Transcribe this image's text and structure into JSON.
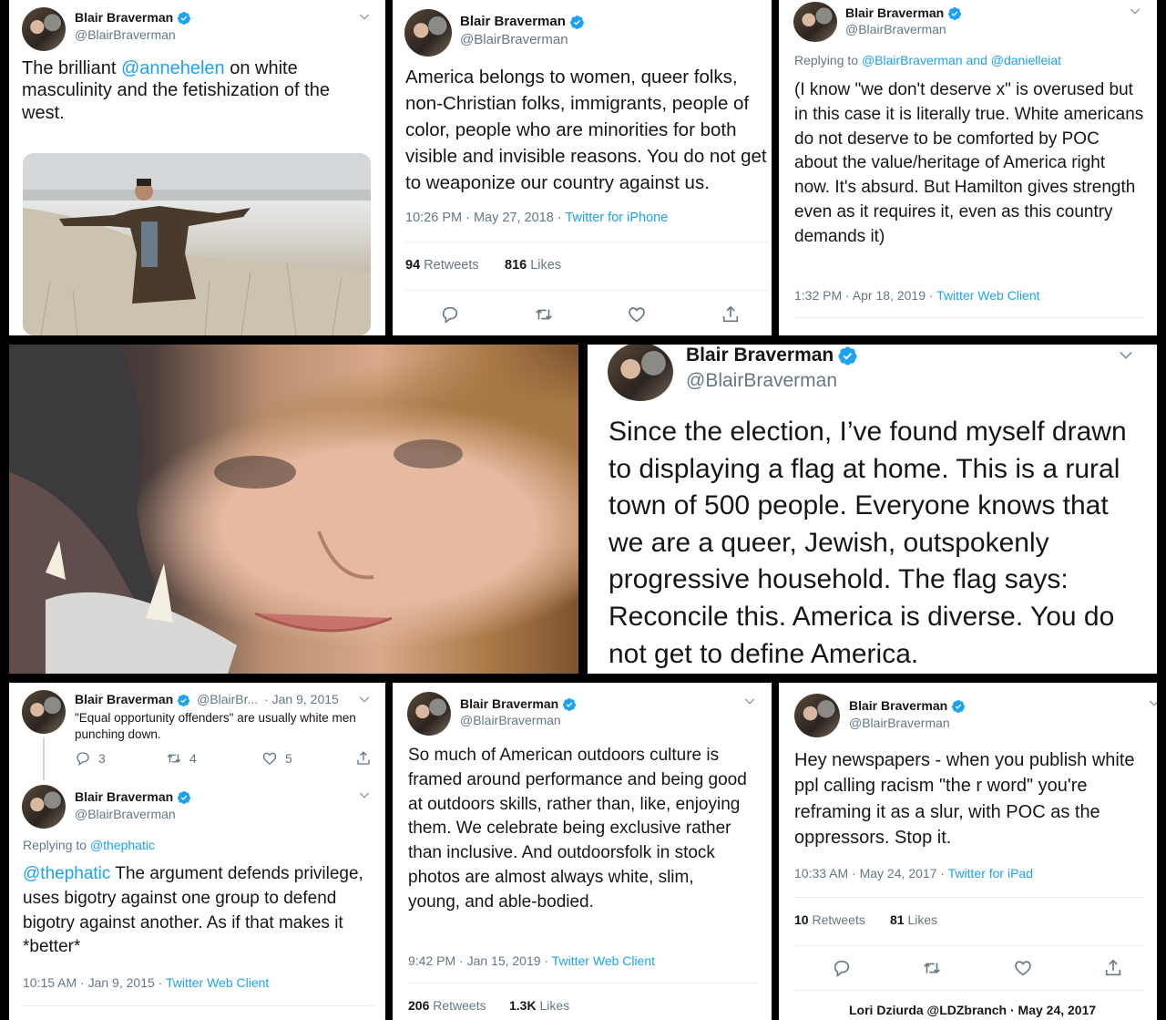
{
  "author": {
    "name": "Blair Braverman",
    "handle": "@BlairBraverman",
    "handle_short": "@BlairBr...",
    "verified_color": "#1da1f2"
  },
  "colors": {
    "link": "#1da1f2",
    "muted": "#657786",
    "text": "#14171a"
  },
  "tweet1": {
    "text_before": "The brilliant ",
    "mention": "@annehelen",
    "text_after": " on white masculinity and the fetishization of the west."
  },
  "tweet2": {
    "text": "America belongs to women, queer folks, non-Christian folks, immigrants, people of color, people who are minorities for both visible and invisible reasons. You do not get to weaponize our country against us.",
    "time": "10:26 PM · May 27, 2018 · ",
    "source": "Twitter for iPhone",
    "retweets_count": "94",
    "retweets_label": "Retweets",
    "likes_count": "816",
    "likes_label": "Likes"
  },
  "tweet3": {
    "replying_label": "Replying to ",
    "replying_to": "@BlairBraverman and @danielleiat",
    "text": "(I know \"we don't deserve x\" is overused but in this case it is literally true. White americans do not deserve to be comforted by POC about the value/heritage of America right now. It's absurd. But Hamilton gives strength even as it requires it, even as this country demands it)",
    "time": "1:32 PM · Apr 18, 2019 · ",
    "source": "Twitter Web Client"
  },
  "tweet4": {
    "text": "Since the election, I’ve found myself drawn to displaying a flag at home. This is a rural town of 500 people. Everyone knows that we are a queer, Jewish, outspokenly progressive household. The flag says: Reconcile this. America is diverse. You do not get to define America."
  },
  "tweet5": {
    "date": "· Jan 9, 2015",
    "text": "\"Equal opportunity offenders\" are usually white men punching down.",
    "replies": "3",
    "retweets": "4",
    "likes": "5"
  },
  "tweet6": {
    "replying_label": "Replying to ",
    "replying_to": "@thephatic",
    "mention": "@thephatic",
    "text_after": " The argument defends privilege, uses bigotry against one group to defend bigotry against another. As if that makes it *better*",
    "time": "10:15 AM · Jan 9, 2015 · ",
    "source": "Twitter Web Client"
  },
  "tweet7": {
    "text": "So much of American outdoors culture is framed around performance and being good at outdoors skills, rather than, like, enjoying them. We celebrate being exclusive rather than inclusive. And outdoorsfolk in stock photos are almost always white, slim, young, and able-bodied.",
    "time": "9:42 PM · Jan 15, 2019 · ",
    "source": "Twitter Web Client",
    "retweets_count": "206",
    "retweets_label": "Retweets",
    "likes_count": "1.3K",
    "likes_label": "Likes"
  },
  "tweet8": {
    "text": "Hey newspapers - when you publish white ppl calling racism \"the r word\" you're reframing it as a slur, with POC as the oppressors. Stop it.",
    "time": "10:33 AM · May 24, 2017 · ",
    "source": "Twitter for iPad",
    "retweets_count": "10",
    "retweets_label": "Retweets",
    "likes_count": "81",
    "likes_label": "Likes",
    "next_reply_preview": "Lori Dziurda @LDZbranch · May 24, 2017"
  }
}
